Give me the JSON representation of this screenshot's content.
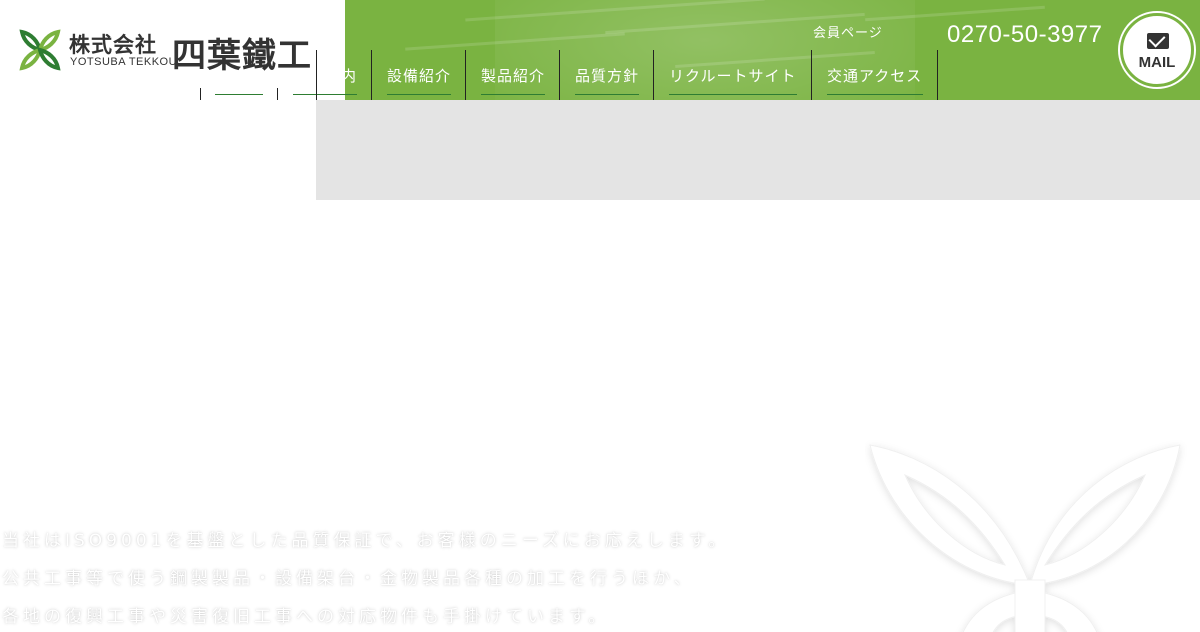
{
  "header": {
    "brand_name_small": "株式会社",
    "brand_name_en": "YOTSUBA TEKKOU",
    "brand_name_large": "四葉鐵工",
    "member_link": "会員ページ",
    "phone": "0270-50-3977",
    "mail_label": "MAIL",
    "accent_color": "#7ab341"
  },
  "nav": {
    "items": [
      {
        "label": "内"
      },
      {
        "label": "設備紹介"
      },
      {
        "label": "製品紹介"
      },
      {
        "label": "品質方針"
      },
      {
        "label": "リクルートサイト"
      },
      {
        "label": "交通アクセス"
      }
    ]
  },
  "hero": {
    "lines": [
      "当社はISO9001を基盤とした品質保証で、お客様のニーズにお応えします。",
      "公共工事等で使う鋼製製品・設備架台・金物製品各種の加工を行うほか、",
      "各地の復興工事や災害復旧工事への対応物件も手掛けています。"
    ]
  }
}
